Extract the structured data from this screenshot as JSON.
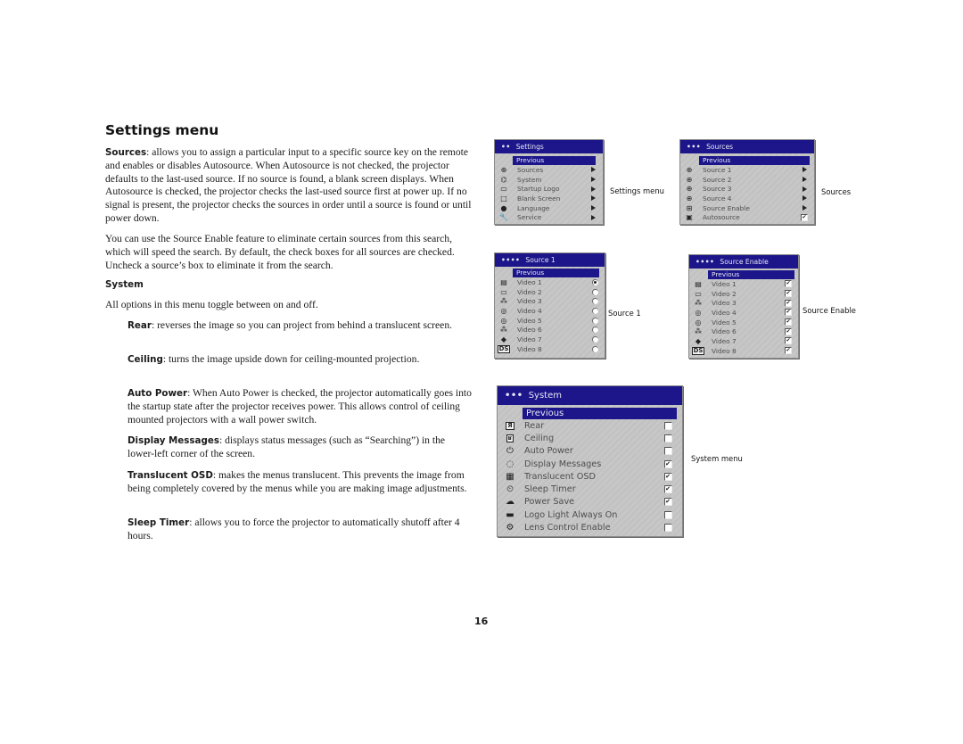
{
  "page": {
    "title": "Settings menu",
    "page_number": "16"
  },
  "text": {
    "sources_term": "Sources",
    "sources_body": ": allows you to assign a particular input to a specific source key on the remote and enables or disables Autosource. When Autosource is not checked, the projector defaults to the last-used source. If no source is found, a blank screen displays. When Autosource is checked, the projector checks the last-used source first at power up. If no signal is present, the projector checks the sources in order until a source is found or until power down.",
    "source_enable_para": "You can use the Source Enable feature to eliminate certain sources from this search, which will speed the search. By default, the check boxes for all sources are checked. Uncheck a source’s box to eliminate it from the search.",
    "system_heading": "System",
    "system_intro": "All options in this menu toggle between on and off.",
    "rear_term": "Rear",
    "rear_body": ": reverses the image so you can project from behind a translucent screen.",
    "ceiling_term": "Ceiling",
    "ceiling_body": ": turns the image upside down for ceiling-mounted projection.",
    "autopower_term": "Auto Power",
    "autopower_body": ": When Auto Power is checked, the projector automatically goes into the startup state after the projector receives power. This allows control of ceiling mounted projectors with a wall power switch.",
    "displaymsg_term": "Display Messages",
    "displaymsg_body": ": displays status messages (such as “Searching”) in the lower-left corner of the screen.",
    "translucent_term": "Translucent OSD",
    "translucent_body": ": makes the menus translucent. This prevents the image from being completely covered by the menus while you are making image adjustments.",
    "sleep_term": "Sleep Timer",
    "sleep_body": ": allows you to force the projector to automatically shutoff after 4 hours."
  },
  "captions": {
    "settings": "Settings menu",
    "sources": "Sources",
    "source1": "Source 1",
    "source_enable": "Source Enable",
    "system": "System menu"
  },
  "menus": {
    "settings": {
      "dots": "••",
      "title": "Settings",
      "previous": "Previous",
      "items": [
        {
          "label": "Sources",
          "icon": "input-icon",
          "glyph": "⊕"
        },
        {
          "label": "System",
          "icon": "system-icon",
          "glyph": "⌬"
        },
        {
          "label": "Startup Logo",
          "icon": "logo-icon",
          "glyph": "▭"
        },
        {
          "label": "Blank Screen",
          "icon": "blank-screen-icon",
          "glyph": "□"
        },
        {
          "label": "Language",
          "icon": "globe-icon",
          "glyph": "●"
        },
        {
          "label": "Service",
          "icon": "wrench-icon",
          "glyph": "🔧"
        }
      ]
    },
    "sources": {
      "dots": "•••",
      "title": "Sources",
      "previous": "Previous",
      "items": [
        {
          "label": "Source 1",
          "control": "arrow"
        },
        {
          "label": "Source 2",
          "control": "arrow"
        },
        {
          "label": "Source 3",
          "control": "arrow"
        },
        {
          "label": "Source 4",
          "control": "arrow"
        },
        {
          "label": "Source Enable",
          "control": "arrow"
        },
        {
          "label": "Autosource",
          "control": "checkbox",
          "checked": true
        }
      ]
    },
    "source1": {
      "dots": "••••",
      "title": "Source 1",
      "previous": "Previous",
      "items": [
        {
          "label": "Video 1",
          "selected": true
        },
        {
          "label": "Video 2",
          "selected": false
        },
        {
          "label": "Video 3",
          "selected": false
        },
        {
          "label": "Video 4",
          "selected": false
        },
        {
          "label": "Video 5",
          "selected": false
        },
        {
          "label": "Video 6",
          "selected": false
        },
        {
          "label": "Video 7",
          "selected": false
        },
        {
          "label": "Video 8",
          "selected": false
        }
      ]
    },
    "source_enable": {
      "dots": "••••",
      "title": "Source Enable",
      "previous": "Previous",
      "items": [
        {
          "label": "Video 1",
          "checked": true
        },
        {
          "label": "Video 2",
          "checked": true
        },
        {
          "label": "Video 3",
          "checked": true
        },
        {
          "label": "Video 4",
          "checked": true
        },
        {
          "label": "Video 5",
          "checked": true
        },
        {
          "label": "Video 6",
          "checked": true
        },
        {
          "label": "Video 7",
          "checked": true
        },
        {
          "label": "Video 8",
          "checked": true
        }
      ]
    },
    "system": {
      "dots": "•••",
      "title": "System",
      "previous": "Previous",
      "items": [
        {
          "label": "Rear",
          "checked": false
        },
        {
          "label": "Ceiling",
          "checked": false
        },
        {
          "label": "Auto Power",
          "checked": false
        },
        {
          "label": "Display Messages",
          "checked": true
        },
        {
          "label": "Translucent OSD",
          "checked": true
        },
        {
          "label": "Sleep Timer",
          "checked": true
        },
        {
          "label": "Power Save",
          "checked": true
        },
        {
          "label": "Logo Light Always On",
          "checked": false
        },
        {
          "label": "Lens Control Enable",
          "checked": false
        }
      ]
    },
    "checkmark": "✔",
    "video_icons": [
      "s-video-icon",
      "monitor-icon",
      "component-icon",
      "composite-icon",
      "composite-icon",
      "component-icon",
      "dvi-icon",
      "ds-icon"
    ],
    "video_glyphs": [
      "▤",
      "▭",
      "⁂",
      "◎",
      "◎",
      "⁂",
      "◆",
      "DS"
    ],
    "system_icons": [
      "rear-icon",
      "ceiling-icon",
      "auto-power-icon",
      "message-icon",
      "translucent-osd-icon",
      "sleep-timer-icon",
      "power-save-icon",
      "logo-light-icon",
      "lens-control-icon"
    ],
    "system_glyphs": [
      "Я",
      "ʁ",
      "⏻",
      "◌",
      "▦",
      "⏲",
      "☁",
      "▬",
      "⚙"
    ]
  }
}
